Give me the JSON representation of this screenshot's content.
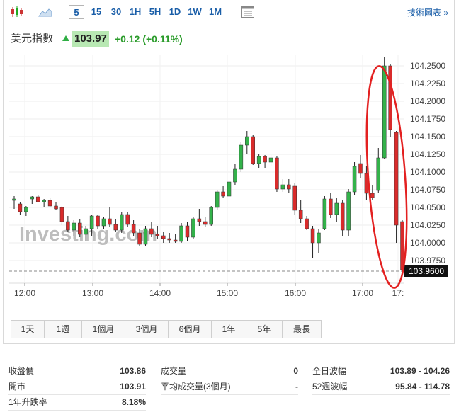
{
  "toolbar": {
    "timeframes": [
      "5",
      "15",
      "30",
      "1H",
      "5H",
      "1D",
      "1W",
      "1M"
    ],
    "active_timeframe": "5",
    "tech_link": "技術圖表 »"
  },
  "quote": {
    "name": "美元指數",
    "price": "103.97",
    "change": "+0.12",
    "change_pct": "(+0.11%)",
    "up_color": "#2fae44"
  },
  "chart_data": {
    "type": "candlestick",
    "watermark": "Investing.com",
    "y_ticks": [
      "104.2500",
      "104.2250",
      "104.2000",
      "104.1750",
      "104.1500",
      "104.1250",
      "104.1000",
      "104.0750",
      "104.0500",
      "104.0250",
      "104.0000",
      "103.9750"
    ],
    "y_range": [
      103.955,
      104.265
    ],
    "x_ticks": [
      "12:00",
      "13:00",
      "14:00",
      "15:00",
      "16:00",
      "17:00",
      "17:"
    ],
    "current_price_label": "103.9600",
    "current_price": 103.96,
    "up_color": "#33b24a",
    "down_color": "#d92b2b",
    "annotation": "red ellipse around 17:00–17:30 candles",
    "candles": [
      {
        "o": 104.06,
        "h": 104.066,
        "l": 104.048,
        "c": 104.062
      },
      {
        "o": 104.055,
        "h": 104.058,
        "l": 104.04,
        "c": 104.044
      },
      {
        "o": 104.044,
        "h": 104.052,
        "l": 104.038,
        "c": 104.05
      },
      {
        "o": 104.062,
        "h": 104.066,
        "l": 104.055,
        "c": 104.065
      },
      {
        "o": 104.065,
        "h": 104.068,
        "l": 104.058,
        "c": 104.058
      },
      {
        "o": 104.058,
        "h": 104.062,
        "l": 104.05,
        "c": 104.06
      },
      {
        "o": 104.06,
        "h": 104.064,
        "l": 104.05,
        "c": 104.052
      },
      {
        "o": 104.052,
        "h": 104.058,
        "l": 104.046,
        "c": 104.048
      },
      {
        "o": 104.05,
        "h": 104.052,
        "l": 104.025,
        "c": 104.03
      },
      {
        "o": 104.03,
        "h": 104.038,
        "l": 104.015,
        "c": 104.018
      },
      {
        "o": 104.018,
        "h": 104.032,
        "l": 104.01,
        "c": 104.028
      },
      {
        "o": 104.028,
        "h": 104.034,
        "l": 104.008,
        "c": 104.012
      },
      {
        "o": 104.012,
        "h": 104.024,
        "l": 104.003,
        "c": 104.02
      },
      {
        "o": 104.02,
        "h": 104.04,
        "l": 104.01,
        "c": 104.038
      },
      {
        "o": 104.038,
        "h": 104.04,
        "l": 104.02,
        "c": 104.024
      },
      {
        "o": 104.024,
        "h": 104.036,
        "l": 104.02,
        "c": 104.034
      },
      {
        "o": 104.034,
        "h": 104.05,
        "l": 104.022,
        "c": 104.026
      },
      {
        "o": 104.026,
        "h": 104.034,
        "l": 104.015,
        "c": 104.018
      },
      {
        "o": 104.018,
        "h": 104.044,
        "l": 104.014,
        "c": 104.04
      },
      {
        "o": 104.04,
        "h": 104.044,
        "l": 104.022,
        "c": 104.026
      },
      {
        "o": 104.026,
        "h": 104.032,
        "l": 104.01,
        "c": 104.014
      },
      {
        "o": 104.014,
        "h": 104.02,
        "l": 103.995,
        "c": 103.998
      },
      {
        "o": 103.998,
        "h": 104.024,
        "l": 103.995,
        "c": 104.02
      },
      {
        "o": 104.02,
        "h": 104.03,
        "l": 104.008,
        "c": 104.012
      },
      {
        "o": 104.012,
        "h": 104.024,
        "l": 104.005,
        "c": 104.01
      },
      {
        "o": 104.01,
        "h": 104.016,
        "l": 104.0,
        "c": 104.006
      },
      {
        "o": 104.006,
        "h": 104.014,
        "l": 104.0,
        "c": 104.004
      },
      {
        "o": 104.004,
        "h": 104.012,
        "l": 104.0,
        "c": 104.002
      },
      {
        "o": 104.002,
        "h": 104.028,
        "l": 104.0,
        "c": 104.024
      },
      {
        "o": 104.024,
        "h": 104.03,
        "l": 104.002,
        "c": 104.008
      },
      {
        "o": 104.008,
        "h": 104.036,
        "l": 104.005,
        "c": 104.034
      },
      {
        "o": 104.034,
        "h": 104.048,
        "l": 104.024,
        "c": 104.03
      },
      {
        "o": 104.03,
        "h": 104.036,
        "l": 104.022,
        "c": 104.026
      },
      {
        "o": 104.026,
        "h": 104.052,
        "l": 104.024,
        "c": 104.05
      },
      {
        "o": 104.05,
        "h": 104.074,
        "l": 104.046,
        "c": 104.072
      },
      {
        "o": 104.072,
        "h": 104.08,
        "l": 104.064,
        "c": 104.066
      },
      {
        "o": 104.066,
        "h": 104.09,
        "l": 104.062,
        "c": 104.086
      },
      {
        "o": 104.086,
        "h": 104.112,
        "l": 104.082,
        "c": 104.104
      },
      {
        "o": 104.104,
        "h": 104.142,
        "l": 104.1,
        "c": 104.138
      },
      {
        "o": 104.138,
        "h": 104.158,
        "l": 104.126,
        "c": 104.15
      },
      {
        "o": 104.15,
        "h": 104.152,
        "l": 104.11,
        "c": 104.112
      },
      {
        "o": 104.112,
        "h": 104.126,
        "l": 104.106,
        "c": 104.122
      },
      {
        "o": 104.122,
        "h": 104.124,
        "l": 104.106,
        "c": 104.114
      },
      {
        "o": 104.114,
        "h": 104.124,
        "l": 104.108,
        "c": 104.12
      },
      {
        "o": 104.12,
        "h": 104.122,
        "l": 104.072,
        "c": 104.076
      },
      {
        "o": 104.076,
        "h": 104.09,
        "l": 104.072,
        "c": 104.082
      },
      {
        "o": 104.082,
        "h": 104.09,
        "l": 104.07,
        "c": 104.076
      },
      {
        "o": 104.08,
        "h": 104.084,
        "l": 104.04,
        "c": 104.046
      },
      {
        "o": 104.046,
        "h": 104.06,
        "l": 104.028,
        "c": 104.034
      },
      {
        "o": 104.034,
        "h": 104.038,
        "l": 104.018,
        "c": 104.02
      },
      {
        "o": 104.02,
        "h": 104.024,
        "l": 103.978,
        "c": 104.0
      },
      {
        "o": 104.0,
        "h": 104.02,
        "l": 103.985,
        "c": 104.014
      },
      {
        "o": 104.02,
        "h": 104.066,
        "l": 104.018,
        "c": 104.062
      },
      {
        "o": 104.062,
        "h": 104.07,
        "l": 104.035,
        "c": 104.04
      },
      {
        "o": 104.04,
        "h": 104.064,
        "l": 104.03,
        "c": 104.056
      },
      {
        "o": 104.056,
        "h": 104.06,
        "l": 104.01,
        "c": 104.018
      },
      {
        "o": 104.018,
        "h": 104.076,
        "l": 104.01,
        "c": 104.072
      },
      {
        "o": 104.072,
        "h": 104.114,
        "l": 104.068,
        "c": 104.108
      },
      {
        "o": 104.112,
        "h": 104.124,
        "l": 104.092,
        "c": 104.098
      },
      {
        "o": 104.098,
        "h": 104.108,
        "l": 104.06,
        "c": 104.07
      },
      {
        "o": 104.07,
        "h": 104.082,
        "l": 104.06,
        "c": 104.064
      },
      {
        "o": 104.074,
        "h": 104.134,
        "l": 104.07,
        "c": 104.12
      },
      {
        "o": 104.12,
        "h": 104.262,
        "l": 104.118,
        "c": 104.25
      },
      {
        "o": 104.25,
        "h": 104.252,
        "l": 104.15,
        "c": 104.16
      },
      {
        "o": 104.156,
        "h": 104.158,
        "l": 104.0,
        "c": 104.025
      },
      {
        "o": 104.03,
        "h": 104.032,
        "l": 103.962,
        "c": 103.962
      }
    ]
  },
  "ranges": [
    "1天",
    "1週",
    "1個月",
    "3個月",
    "6個月",
    "1年",
    "5年",
    "最長"
  ],
  "stats": [
    {
      "label": "收盤價",
      "value": "103.86"
    },
    {
      "label": "開市",
      "value": "103.91"
    },
    {
      "label": "1年升跌率",
      "value": "8.18%"
    },
    {
      "label": "成交量",
      "value": "0"
    },
    {
      "label": "平均成交量(3個月)",
      "value": "-"
    },
    {
      "label": "全日波幅",
      "value": "103.89 - 104.26"
    },
    {
      "label": "52週波幅",
      "value": "95.84 - 114.78"
    }
  ]
}
